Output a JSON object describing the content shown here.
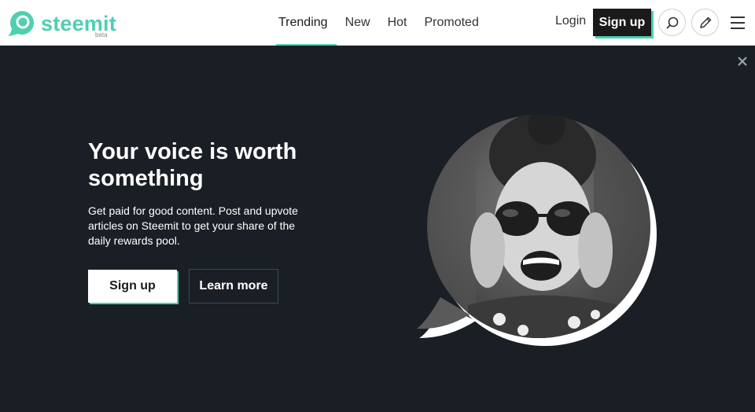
{
  "header": {
    "logo": {
      "word": "steemit",
      "beta": "beta"
    },
    "nav": [
      {
        "label": "Trending",
        "active": true
      },
      {
        "label": "New",
        "active": false
      },
      {
        "label": "Hot",
        "active": false
      },
      {
        "label": "Promoted",
        "active": false
      }
    ],
    "login_label": "Login",
    "signup_label": "Sign up",
    "icons": [
      "search-icon",
      "pencil-icon",
      "hamburger-menu-icon"
    ]
  },
  "hero": {
    "title": "Your voice is worth something",
    "text": "Get paid for good content. Post and upvote articles on Steemit to get your share of the daily rewards pool.",
    "signup_label": "Sign up",
    "learn_more_label": "Learn more",
    "close_icon": "close-icon"
  },
  "colors": {
    "accent": "#4fcfb0",
    "hero_background": "#1a1f25",
    "header_button": "#1a1a1a"
  }
}
